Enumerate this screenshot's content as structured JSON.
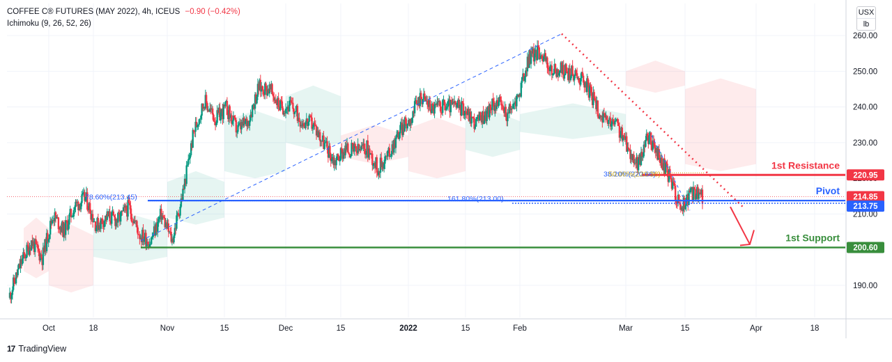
{
  "header": {
    "symbol_line": "COFFEE C® FUTURES (MAY 2022), 4h, ICEUS",
    "change": "−0.90 (−0.42%)",
    "indicator": "Ichimoku (9, 26, 52, 26)"
  },
  "unit_selector": {
    "currency": "USX",
    "unit": "lb"
  },
  "branding": {
    "logo_text": "17",
    "name": "TradingView"
  },
  "chart_data": {
    "type": "candlestick",
    "y_axis": {
      "ticks": [
        190,
        200,
        210,
        220,
        230,
        240,
        250,
        260
      ],
      "min": 181,
      "max": 269,
      "position": "right"
    },
    "x_axis": {
      "labels": [
        "Oct",
        "18",
        "Nov",
        "15",
        "Dec",
        "15",
        "2022",
        "15",
        "Feb",
        "Mar",
        "15",
        "Apr",
        "18"
      ]
    },
    "levels": [
      {
        "name": "1st Resistance",
        "value": 220.95,
        "label": "220.95",
        "color": "#f23645"
      },
      {
        "name": "Pivot",
        "value": 213.75,
        "label": "213.75",
        "color": "#2962ff"
      },
      {
        "name": "1st Support",
        "value": 200.6,
        "label": "200.60",
        "color": "#388e3c"
      }
    ],
    "current_price": {
      "value": 214.85,
      "label": "214.85",
      "color": "#f23645"
    },
    "fib_annotations": [
      {
        "text": "78.60%(213.45)"
      },
      {
        "text": "161.80%(213.00)"
      },
      {
        "text": "38.20%(220.66)"
      },
      {
        "text": "50.00%(220.36)"
      }
    ],
    "price_path": [
      [
        186.5,
        188
      ],
      [
        193,
        199
      ],
      [
        201.5,
        203
      ],
      [
        197,
        198.5
      ],
      [
        205,
        214.5
      ],
      [
        203,
        207.5
      ],
      [
        205,
        219.5
      ],
      [
        211.5,
        217.5
      ],
      [
        205.5,
        208
      ],
      [
        207,
        211.5
      ],
      [
        203,
        213.5
      ],
      [
        209.5,
        214.5
      ],
      [
        202,
        206.5
      ],
      [
        201,
        203.5
      ],
      [
        206.5,
        213.5
      ],
      [
        201.5,
        203.5
      ],
      [
        209.5,
        222.5
      ],
      [
        230,
        236
      ],
      [
        237,
        246.5
      ],
      [
        234.5,
        238.5
      ],
      [
        236,
        243.5
      ],
      [
        229,
        238
      ],
      [
        232,
        240
      ],
      [
        239,
        252
      ],
      [
        243,
        247
      ],
      [
        238,
        242
      ],
      [
        236.5,
        244
      ],
      [
        233,
        239
      ],
      [
        234.5,
        236
      ],
      [
        228,
        232
      ],
      [
        223.5,
        226
      ],
      [
        226,
        230.5
      ],
      [
        226,
        229
      ],
      [
        227,
        230
      ],
      [
        221,
        224.5
      ],
      [
        223.5,
        230
      ],
      [
        230.5,
        236
      ],
      [
        232.5,
        241
      ],
      [
        242,
        244.5
      ],
      [
        236,
        243.5
      ],
      [
        235.5,
        245
      ],
      [
        237.5,
        243
      ],
      [
        236.5,
        242.5
      ],
      [
        232.5,
        238.5
      ],
      [
        236,
        240
      ],
      [
        238.5,
        245
      ],
      [
        235.5,
        240
      ],
      [
        240,
        246
      ],
      [
        249.5,
        258.5
      ],
      [
        252,
        259.5
      ],
      [
        245,
        255
      ],
      [
        246,
        254.5
      ],
      [
        245.5,
        253
      ],
      [
        244,
        252
      ],
      [
        238.5,
        244.5
      ],
      [
        234.5,
        236.5
      ],
      [
        234,
        237
      ],
      [
        226.5,
        232
      ],
      [
        222,
        225
      ],
      [
        229.5,
        234
      ],
      [
        223.5,
        228
      ],
      [
        219,
        221.5
      ],
      [
        210.5,
        212.5
      ],
      [
        215,
        216.5
      ],
      [
        214.5,
        215.5
      ]
    ],
    "ichimoku_cloud": [
      {
        "from": "Oct",
        "to": "18",
        "color": "#f23645"
      },
      {
        "from": "18",
        "to": "Dec",
        "color": "#089981"
      },
      {
        "from": "Dec",
        "to": "2022",
        "color": "#089981"
      },
      {
        "from": "2022",
        "to": "15",
        "color": "#f23645"
      },
      {
        "from": "15",
        "to": "Mar",
        "color": "#089981"
      },
      {
        "from": "Mar",
        "to": "Apr",
        "color": "#f23645"
      }
    ],
    "annotations": [
      {
        "type": "dashed-trend",
        "from": [
          202.5,
          "Nov"
        ],
        "to": [
          260.5,
          "Feb"
        ],
        "color": "#2962ff"
      },
      {
        "type": "dashed-downtrend",
        "from": [
          260.5,
          "Feb"
        ],
        "to": [
          212,
          "Apr"
        ],
        "color": "#f23645"
      },
      {
        "type": "arrow-down",
        "color": "#f23645"
      }
    ],
    "colors": {
      "up": "#089981",
      "down": "#f23645",
      "grid": "#f0f3fa",
      "axis_text": "#131722"
    }
  }
}
